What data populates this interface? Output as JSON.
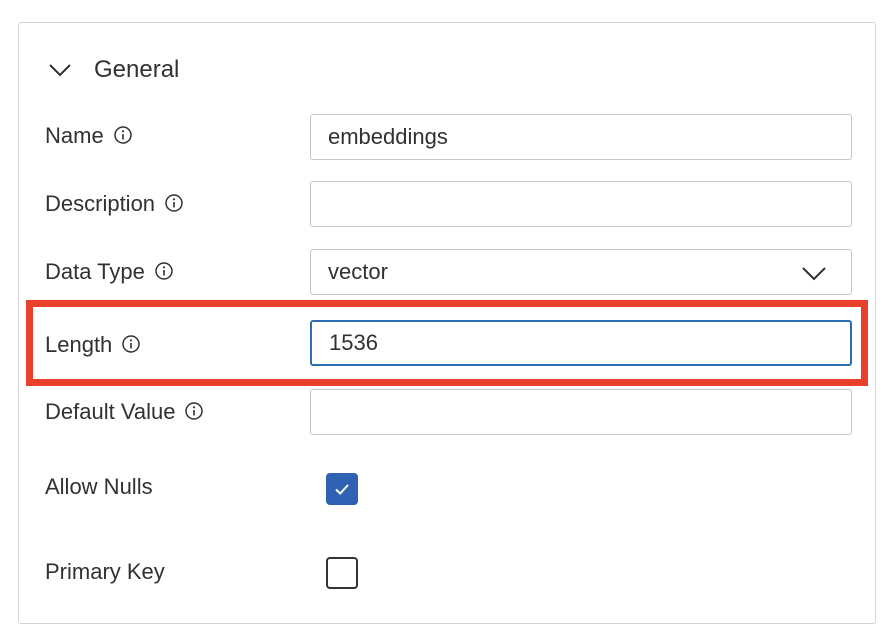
{
  "section": {
    "title": "General",
    "expanded": true
  },
  "fields": {
    "name": {
      "label": "Name",
      "value": "embeddings",
      "info_icon": "info-icon"
    },
    "description": {
      "label": "Description",
      "value": "",
      "info_icon": "info-icon"
    },
    "data_type": {
      "label": "Data Type",
      "value": "vector",
      "info_icon": "info-icon"
    },
    "length": {
      "label": "Length",
      "value": "1536",
      "info_icon": "info-icon",
      "focused": true
    },
    "default_value": {
      "label": "Default Value",
      "value": "",
      "info_icon": "info-icon"
    },
    "allow_nulls": {
      "label": "Allow Nulls",
      "checked": true
    },
    "primary_key": {
      "label": "Primary Key",
      "checked": false
    }
  },
  "colors": {
    "accent": "#2f62b3",
    "focus_border": "#2f6db3",
    "highlight": "#e8402a",
    "text": "#323130",
    "border": "#c8c6c4"
  }
}
